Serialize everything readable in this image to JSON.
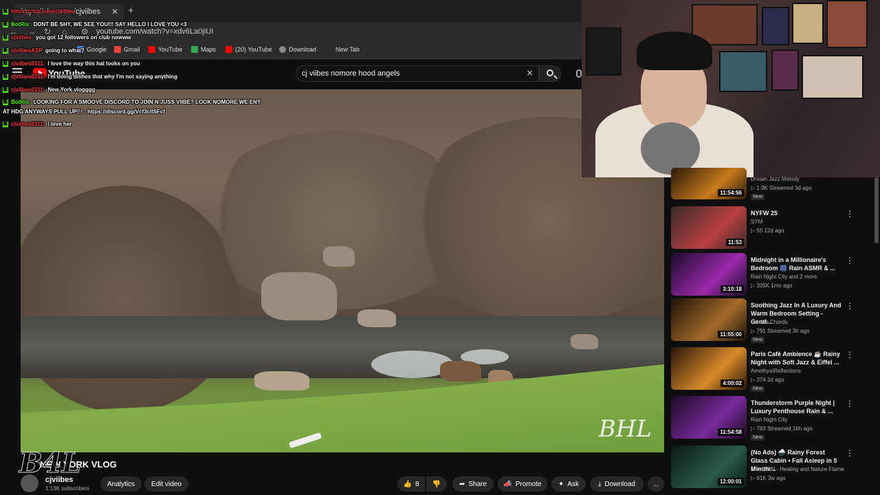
{
  "browser": {
    "tab_title": "https://club.com/cjviibes",
    "tab_close": "✕",
    "new_tab": "+",
    "url": "youtube.com/watch?v=xdv6La0jiUI",
    "bookmarks": [
      "Google",
      "Gmail",
      "YouTube",
      "Maps",
      "(20) YouTube",
      "Download",
      "New Tab"
    ]
  },
  "youtube": {
    "logo_text": "YouTube",
    "search_query": "cj viibes nomore hood angels"
  },
  "video": {
    "title": "NEW YORK VLOG",
    "channel": "cjviibes",
    "subscribers": "1.13K subscribers",
    "watermark": "BHL",
    "signature": "B4L",
    "actions": {
      "analytics": "Analytics",
      "edit": "Edit video",
      "likes": "8",
      "share": "Share",
      "promote": "Promote",
      "ask": "Ask",
      "download": "Download",
      "more": "..."
    }
  },
  "chat": [
    {
      "user": "BotRix:",
      "bot": true,
      "msg": "DONT BE SHY, WE SEE YOU!!! SAY HELLO I LOVE YOU <3"
    },
    {
      "user": "cjviibes:",
      "bot": false,
      "msg": "you got 12 followers on club nowww"
    },
    {
      "user": "cjviibesASP",
      "bot": false,
      "msg": "going to what?"
    },
    {
      "user": "cjviibes0311:",
      "bot": false,
      "msg": "I love the way this hat looks on you"
    },
    {
      "user": "cjviibes0311:",
      "bot": false,
      "msg": "I'm doing dishes that why I'm not saying anything"
    },
    {
      "user": "cjviibes0311:",
      "bot": false,
      "msg": "New York vlogggg"
    },
    {
      "user": "BotRix:",
      "bot": true,
      "msg": "LOOKING FOR A SMOOVE DISCORD TO JOIN N JUSS VIIBE? LOOK NOMORE WE ENY"
    },
    {
      "user": "",
      "bot": false,
      "msg": "AT HDG ANYWAYS PULL UP!!! - https://discord.gg/Vcf3clISFcf"
    },
    {
      "user": "cjviibes0311:",
      "bot": false,
      "msg": "I love her"
    }
  ],
  "recommendations": [
    {
      "title": "",
      "channel": "Dream Jazz Melody",
      "meta": "▷ 1.9K  Streamed 3d ago",
      "duration": "11:54:56",
      "is_new": true,
      "new_label": "New",
      "colors": [
        "#2a1a08",
        "#c77a1e"
      ]
    },
    {
      "title": "NYFW 25",
      "channel": "SYM",
      "meta": "▷ 55  12d ago",
      "duration": "11:53",
      "is_new": false,
      "colors": [
        "#3a2a2a",
        "#b84040"
      ]
    },
    {
      "title": "Midnight in a Millionaire's Bedroom 🎆 Rain ASMR & ...",
      "channel": "Rain Night City and 2 more",
      "meta": "▷ 205K  1mo ago",
      "duration": "3:10:18",
      "is_new": false,
      "colors": [
        "#1a0a2a",
        "#9a2aa8"
      ]
    },
    {
      "title": "Soothing Jazz In A Luxury And Warm Bedroom Setting - Gentl...",
      "channel": "Serene Chords",
      "meta": "▷ 791  Streamed 3h ago",
      "duration": "11:55:00",
      "is_new": true,
      "new_label": "New",
      "colors": [
        "#1e140a",
        "#a36a2a"
      ]
    },
    {
      "title": "Paris Café Ambience ☕ Rainy Night with Soft Jazz & Eiffel ...",
      "channel": "AmethystReflections",
      "meta": "▷ 374  2d ago",
      "duration": "4:00:02",
      "is_new": true,
      "new_label": "New",
      "colors": [
        "#2a1608",
        "#d88a2a"
      ]
    },
    {
      "title": "Thunderstorm Purple Night | Luxury Penthouse Rain & ...",
      "channel": "Rain Night City",
      "meta": "▷ 783  Streamed 16h ago",
      "duration": "11:54:58",
      "is_new": true,
      "new_label": "New",
      "colors": [
        "#1a0a24",
        "#7a2a9a"
      ]
    },
    {
      "title": "(No Ads) 🌧️ Rainy Forest Glass Cabin • Fall Asleep in 5 Minute...",
      "channel": "The RAIN - Healing and Nature Flame",
      "meta": "▷ 61K  3w ago",
      "duration": "12:00:01",
      "is_new": false,
      "colors": [
        "#0a1a14",
        "#2a5a4a"
      ]
    }
  ],
  "colors": {
    "accent_red": "#ff0000",
    "chat_green": "#53fc18",
    "bg": "#0f0f0f"
  }
}
